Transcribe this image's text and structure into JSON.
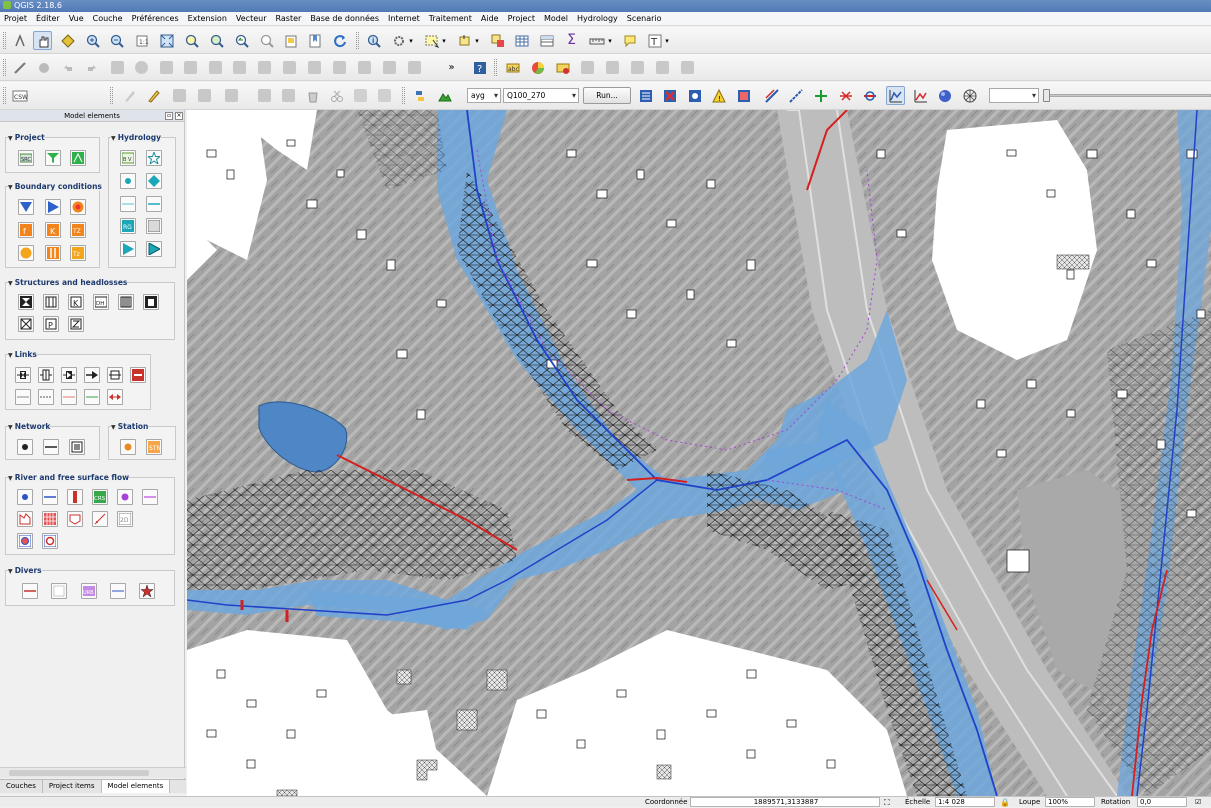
{
  "window": {
    "title": "QGIS 2.18.6"
  },
  "menu": [
    "Projet",
    "Éditer",
    "Vue",
    "Couche",
    "Préférences",
    "Extension",
    "Vecteur",
    "Raster",
    "Base de données",
    "Internet",
    "Traitement",
    "Aide",
    "Project",
    "Model",
    "Hydrology",
    "Scenario"
  ],
  "toolbar3": {
    "scenario_select": "ayg",
    "run_select": "Q100_270",
    "run_button": "Run..."
  },
  "panel": {
    "title": "Model elements",
    "groups": {
      "project": "Project",
      "hydrology": "Hydrology",
      "boundary": "Boundary conditions",
      "structures": "Structures and headlosses",
      "links": "Links",
      "network": "Network",
      "station": "Station",
      "river": "River and free surface flow",
      "divers": "Divers"
    },
    "tabs": [
      "Couches",
      "Project items",
      "Model elements"
    ]
  },
  "statusbar": {
    "coord_label": "Coordonnée",
    "coord_value": "1889571,3133887",
    "scale_label": "Échelle",
    "scale_value": "1:4 028",
    "magnifier_label": "Loupe",
    "magnifier_value": "100%",
    "rotation_label": "Rotation",
    "rotation_value": "0,0"
  },
  "colors": {
    "water": "#6fa7dc",
    "river_line": "#2142c8",
    "pipe_red": "#d42020",
    "mesh": "#1a1a1a",
    "hillshade": "#9c9c9c"
  }
}
